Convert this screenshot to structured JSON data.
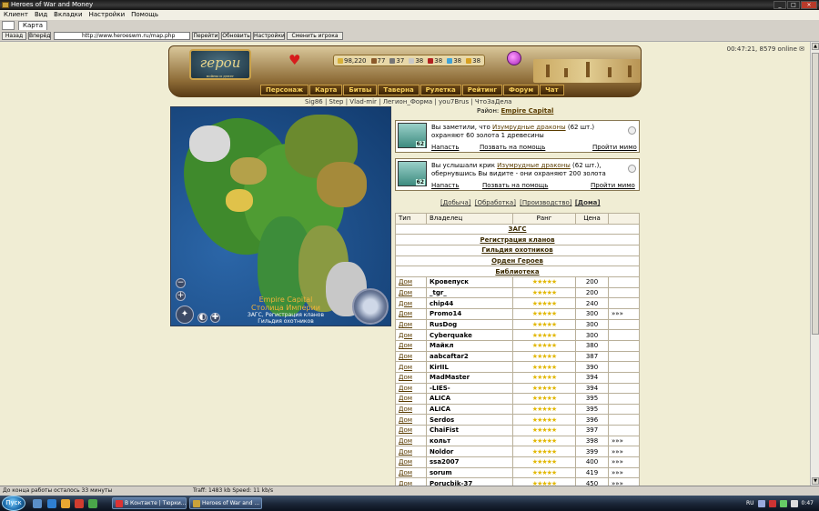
{
  "window": {
    "title": "Heroes of War and Money"
  },
  "menu": [
    "Клиент",
    "Вид",
    "Вкладки",
    "Настройки",
    "Помощь"
  ],
  "tab": {
    "label": "Карта"
  },
  "nav": {
    "back": "Назад",
    "forward": "Вперёд",
    "url": "http://www.heroeswm.ru/map.php",
    "go": "Перейти",
    "refresh": "Обновить",
    "settings": "Настройки",
    "switch_player": "Сменить игрока"
  },
  "header": {
    "clock": "00:47:21, 8579 online",
    "logo_text": "герои",
    "logo_sub": "войны и денег"
  },
  "resources": [
    {
      "value": "98,220",
      "color": "#d8b23a",
      "icon": "gold-icon"
    },
    {
      "value": "77",
      "color": "#8b5a2b",
      "icon": "wood-icon"
    },
    {
      "value": "37",
      "color": "#777777",
      "icon": "ore-icon"
    },
    {
      "value": "38",
      "color": "#c8c8c8",
      "icon": "mercury-icon"
    },
    {
      "value": "38",
      "color": "#b32020",
      "icon": "crystal-icon"
    },
    {
      "value": "38",
      "color": "#3fa3d8",
      "icon": "gems-icon"
    },
    {
      "value": "38",
      "color": "#d8a020",
      "icon": "sulfur-icon"
    }
  ],
  "main_nav": [
    "Персонаж",
    "Карта",
    "Битвы",
    "Таверна",
    "Рулетка",
    "Рейтинг",
    "Форум",
    "Чат"
  ],
  "player_links": "Sig86 | Step | Vlad-mir | Легион_Форма | you7Brus | ЧтоЗаДела",
  "map": {
    "title": "Empire Capital",
    "subtitle": "Столица Империи",
    "caption1": "ЗАГС, Регистрация кланов",
    "caption2": "Гильдия охотников"
  },
  "district": {
    "label": "Район:",
    "value": "Empire Capital"
  },
  "events": [
    {
      "pre": "Вы заметили, что ",
      "link": "Изумрудные драконы",
      "post": " (62 шт.) охраняют 60 золота 1 древесины",
      "count": "62",
      "attack": "Напасть",
      "help": "Позвать на помощь",
      "pass": "Пройти мимо"
    },
    {
      "pre": "Вы услышали крик ",
      "link": "Изумрудные драконы",
      "post": " (62 шт.), обернувшись Вы видите - они охраняют 200 золота",
      "count": "62",
      "attack": "Напасть",
      "help": "Позвать на помощь",
      "pass": "Пройти мимо"
    }
  ],
  "filters": {
    "f1": "[Добыча]",
    "f2": "[Обработка]",
    "f3": "[Производство]",
    "f4": "[Дома]"
  },
  "table": {
    "headers": [
      "Тип",
      "Владелец",
      "Ранг",
      "Цена",
      ""
    ],
    "sections": [
      "ЗАГС",
      "Регистрация кланов",
      "Гильдия охотников",
      "Орден Героев",
      "Библиотека"
    ],
    "rows": [
      {
        "type": "Дом",
        "owner": "Кровепуск",
        "price": "200",
        "extra": ""
      },
      {
        "type": "Дом",
        "owner": "_tgr_",
        "price": "200",
        "extra": ""
      },
      {
        "type": "Дом",
        "owner": "chip44",
        "price": "240",
        "extra": ""
      },
      {
        "type": "Дом",
        "owner": "Promo14",
        "price": "300",
        "extra": "»»»"
      },
      {
        "type": "Дом",
        "owner": "RusDog",
        "price": "300",
        "extra": ""
      },
      {
        "type": "Дом",
        "owner": "Cyberquake",
        "price": "300",
        "extra": ""
      },
      {
        "type": "Дом",
        "owner": "Майкл",
        "price": "380",
        "extra": ""
      },
      {
        "type": "Дом",
        "owner": "aabcaftar2",
        "price": "387",
        "extra": ""
      },
      {
        "type": "Дом",
        "owner": "KirIIL",
        "price": "390",
        "extra": ""
      },
      {
        "type": "Дом",
        "owner": "MadMaster",
        "price": "394",
        "extra": ""
      },
      {
        "type": "Дом",
        "owner": "-LIES-",
        "price": "394",
        "extra": ""
      },
      {
        "type": "Дом",
        "owner": "ALICA",
        "price": "395",
        "extra": ""
      },
      {
        "type": "Дом",
        "owner": "ALICA",
        "price": "395",
        "extra": ""
      },
      {
        "type": "Дом",
        "owner": "Serdos",
        "price": "396",
        "extra": ""
      },
      {
        "type": "Дом",
        "owner": "ChaiFist",
        "price": "397",
        "extra": ""
      },
      {
        "type": "Дом",
        "owner": "кольт",
        "price": "398",
        "extra": "»»»"
      },
      {
        "type": "Дом",
        "owner": "Noldor",
        "price": "399",
        "extra": "»»»"
      },
      {
        "type": "Дом",
        "owner": "ssa2007",
        "price": "400",
        "extra": "»»»"
      },
      {
        "type": "Дом",
        "owner": "sorum",
        "price": "419",
        "extra": "»»»"
      },
      {
        "type": "Дом",
        "owner": "Porucbik-37",
        "price": "450",
        "extra": "»»»"
      }
    ]
  },
  "status": {
    "left": "До конца работы осталось 33 минуты",
    "mid": "Traff: 1483 kb Speed: 11 kb/s"
  },
  "taskbar": {
    "start": "Пуск",
    "items": [
      "В Контакте | Тюрки...",
      "Heroes of War and ..."
    ],
    "lang": "RU",
    "time": "0:47"
  }
}
